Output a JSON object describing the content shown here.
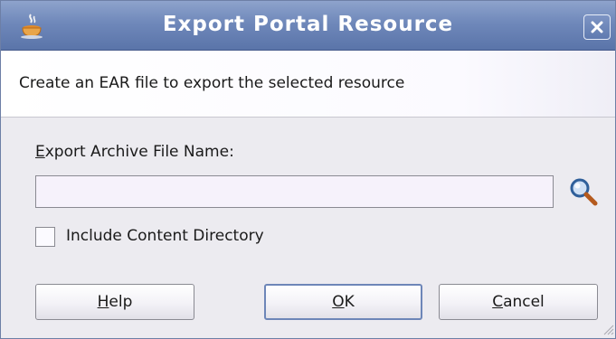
{
  "window": {
    "title": "Export Portal Resource",
    "app_icon": "java-cup-icon",
    "close_icon": "close-icon"
  },
  "banner": {
    "text": "Create an EAR file to export the selected resource"
  },
  "form": {
    "file_label_mnemonic": "E",
    "file_label_rest": "xport Archive File Name:",
    "file_value": "",
    "browse_icon": "search-icon",
    "include_content_checked": false,
    "include_content_label": "Include Content Directory"
  },
  "buttons": {
    "help_mnemonic": "H",
    "help_rest": "elp",
    "ok_mnemonic": "O",
    "ok_rest": "K",
    "cancel_mnemonic": "C",
    "cancel_rest": "ancel"
  },
  "colors": {
    "titlebar": "#6f88ba",
    "title_text": "#ffffff",
    "dialog_bg": "#ecebf0",
    "default_button_border": "#6d86b8"
  }
}
